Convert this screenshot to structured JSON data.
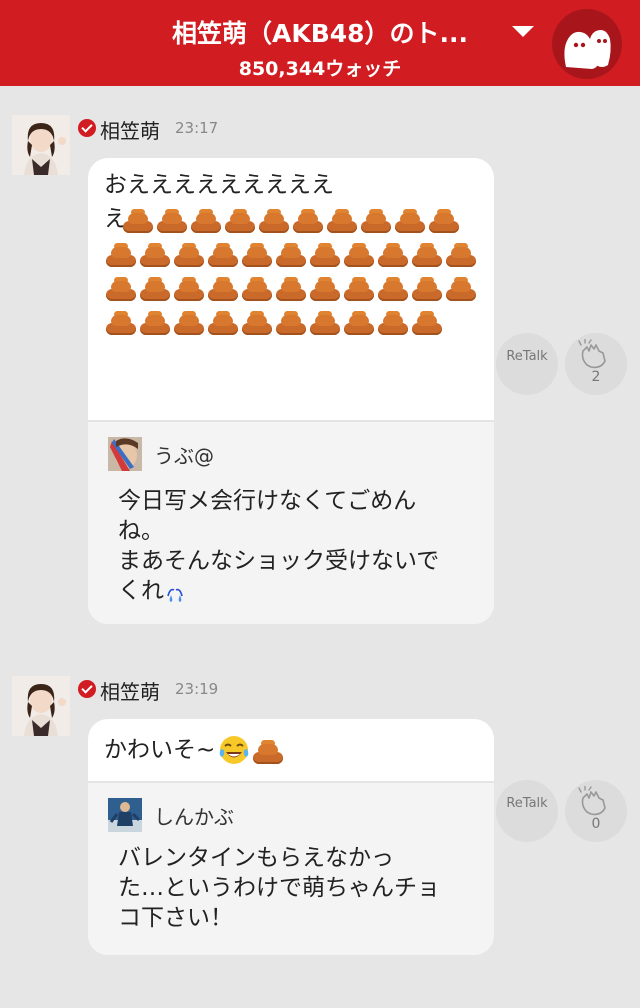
{
  "header": {
    "title": "相笠萌（AKB48）のト...",
    "watch_count": "850,344ウォッチ"
  },
  "messages": [
    {
      "author": "相笠萌",
      "time": "23:17",
      "text_line1": "おえええええええええ",
      "text_line2": "え",
      "emoji_poop_count": 42,
      "retalk_label": "ReTalk",
      "clap_count": "2",
      "reply": {
        "username": "うぶ@",
        "text": "今日写メ会行けなくてごめん\nね。\nまあそんなショック受けないで\nくれ"
      }
    },
    {
      "author": "相笠萌",
      "time": "23:19",
      "text": "かわいそ~",
      "retalk_label": "ReTalk",
      "clap_count": "0",
      "reply": {
        "username": "しんかぶ",
        "text": "バレンタインもらえなかっ\nた…というわけで萌ちゃんチョ\nコ下さい！"
      }
    }
  ],
  "colors": {
    "brand_red": "#d11d22",
    "background": "#e6e6e6"
  }
}
